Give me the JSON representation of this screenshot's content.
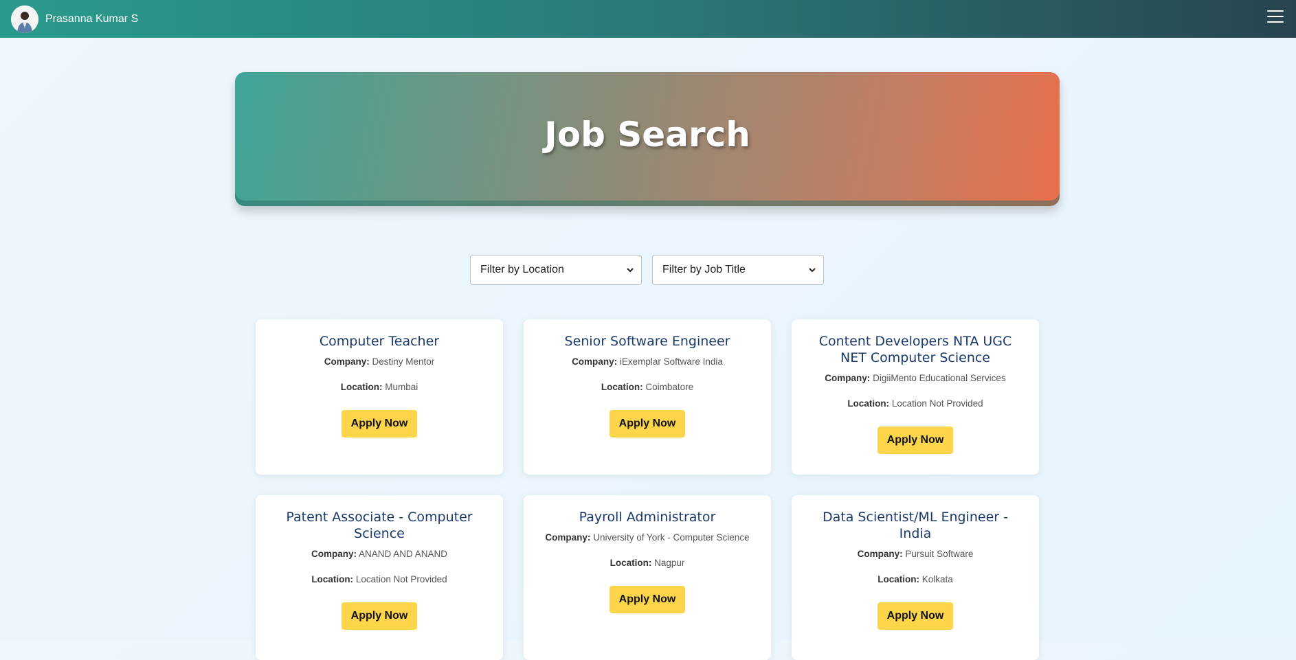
{
  "header": {
    "user_name": "Prasanna Kumar S",
    "menu_icon": "hamburger-menu-icon"
  },
  "hero": {
    "title": "Job Search"
  },
  "filters": {
    "location": "Filter by Location",
    "job_title": "Filter by Job Title"
  },
  "labels": {
    "company": "Company:",
    "location": "Location:",
    "apply": "Apply Now"
  },
  "jobs": [
    {
      "title": "Computer Teacher",
      "company": "Destiny Mentor",
      "location": "Mumbai"
    },
    {
      "title": "Senior Software Engineer",
      "company": "iExemplar Software India",
      "location": "Coimbatore"
    },
    {
      "title": "Content Developers NTA UGC NET Computer Science",
      "company": "DigiiMento Educational Services",
      "location": "Location Not Provided"
    },
    {
      "title": "Patent Associate - Computer Science",
      "company": "ANAND AND ANAND",
      "location": "Location Not Provided"
    },
    {
      "title": "Payroll Administrator",
      "company": "University of York - Computer Science",
      "location": "Nagpur"
    },
    {
      "title": "Data Scientist/ML Engineer - India",
      "company": "Pursuit Software",
      "location": "Kolkata"
    }
  ],
  "colors": {
    "apply_button": "#fcd54b",
    "job_title": "#1a3a6b"
  }
}
